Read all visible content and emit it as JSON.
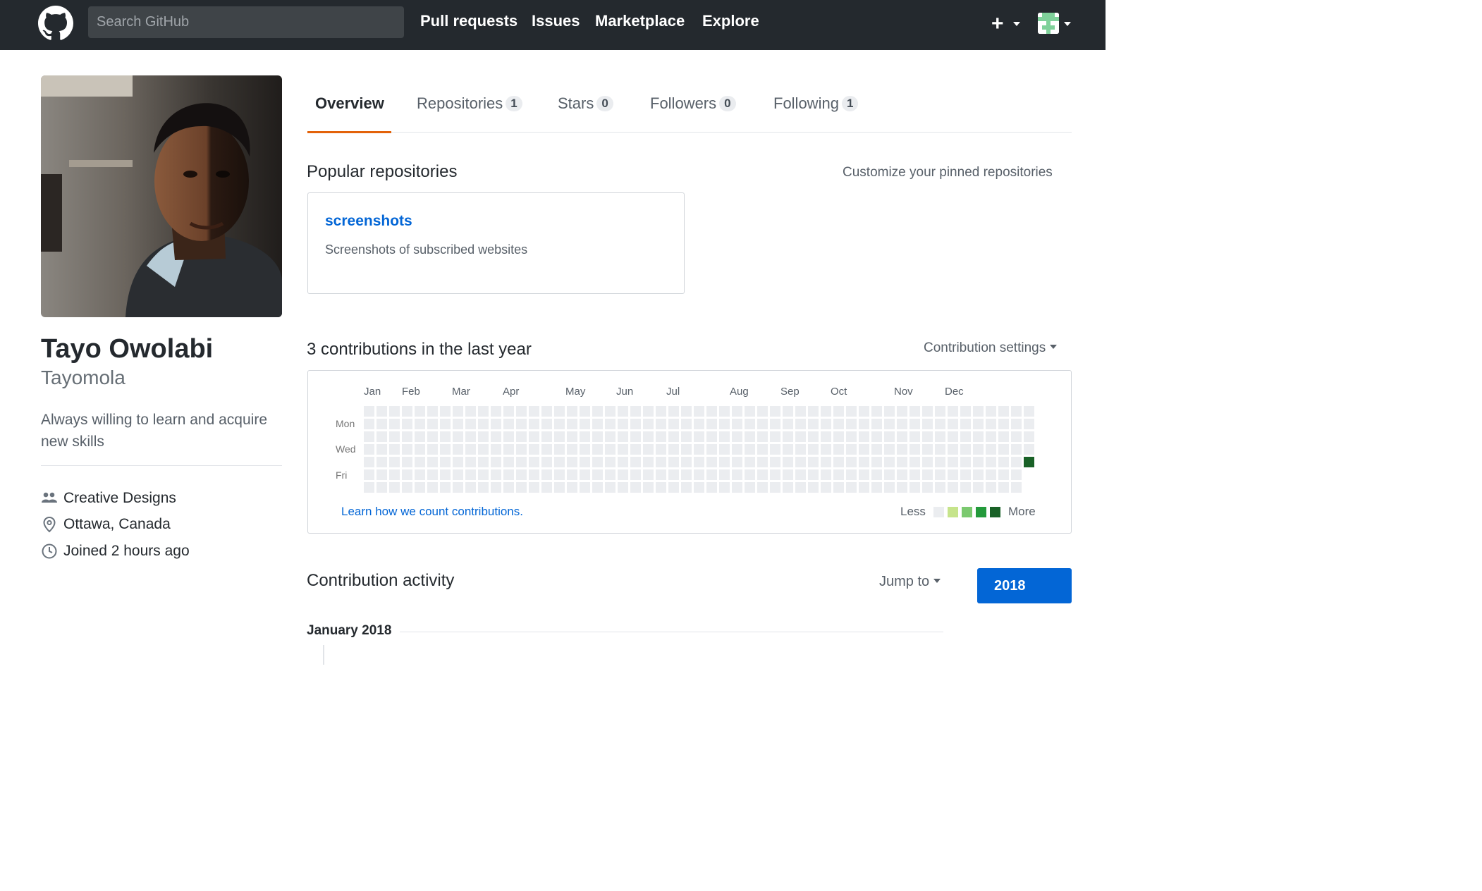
{
  "header": {
    "search_placeholder": "Search GitHub",
    "nav": [
      "Pull requests",
      "Issues",
      "Marketplace",
      "Explore"
    ],
    "new_icon": "plus-icon",
    "logo_icon": "github-mark-icon"
  },
  "profile": {
    "full_name": "Tayo Owolabi",
    "username": "Tayomola",
    "bio": "Always willing to learn and acquire new skills",
    "organization": "Creative Designs",
    "location": "Ottawa, Canada",
    "joined": "Joined 2 hours ago"
  },
  "tabs": [
    {
      "label": "Overview",
      "count": null
    },
    {
      "label": "Repositories",
      "count": "1"
    },
    {
      "label": "Stars",
      "count": "0"
    },
    {
      "label": "Followers",
      "count": "0"
    },
    {
      "label": "Following",
      "count": "1"
    }
  ],
  "popular": {
    "title": "Popular repositories",
    "customize": "Customize your pinned repositories",
    "repo_name": "screenshots",
    "repo_desc": "Screenshots of subscribed websites"
  },
  "contributions": {
    "title": "3 contributions in the last year",
    "settings": "Contribution settings",
    "months": [
      "Jan",
      "Feb",
      "Mar",
      "Apr",
      "May",
      "Jun",
      "Jul",
      "Aug",
      "Sep",
      "Oct",
      "Nov",
      "Dec"
    ],
    "weekdays": [
      "Mon",
      "Wed",
      "Fri"
    ],
    "learn": "Learn how we count contributions.",
    "less": "Less",
    "more": "More",
    "colors": [
      "#ebedf0",
      "#c6e48b",
      "#7bc96f",
      "#239a3b",
      "#196127"
    ]
  },
  "activity": {
    "title": "Contribution activity",
    "jump": "Jump to",
    "year": "2018",
    "month_heading": "January 2018"
  }
}
